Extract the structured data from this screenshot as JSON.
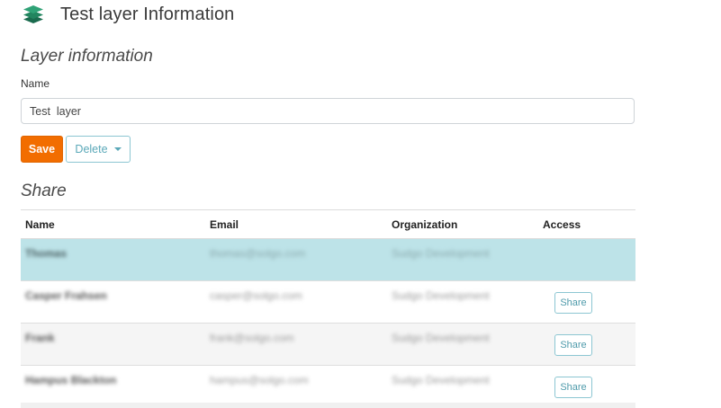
{
  "header": {
    "title": "Test layer Information",
    "icon": "layers-icon"
  },
  "layer_info": {
    "section_title": "Layer information",
    "name_label": "Name",
    "name_value": "Test  layer",
    "save_label": "Save",
    "delete_label": "Delete"
  },
  "share": {
    "section_title": "Share",
    "columns": {
      "name": "Name",
      "email": "Email",
      "organization": "Organization",
      "access": "Access"
    },
    "rows": [
      {
        "name": "Thomas",
        "email": "thomas@solgo.com",
        "organization": "Sudgo Development",
        "access_label": ""
      },
      {
        "name": "Casper Frahsen",
        "email": "casper@solgo.com",
        "organization": "Sudgo Development",
        "access_label": "Share"
      },
      {
        "name": "Frank",
        "email": "frank@solgo.com",
        "organization": "Sudgo Development",
        "access_label": "Share"
      },
      {
        "name": "Hampus Blackton",
        "email": "hampus@solgo.com",
        "organization": "Sudgo Development",
        "access_label": "Share"
      }
    ]
  },
  "colors": {
    "accent": "#f26d00",
    "highlight_row": "#bde3e8",
    "outline": "#8cc6d2"
  }
}
